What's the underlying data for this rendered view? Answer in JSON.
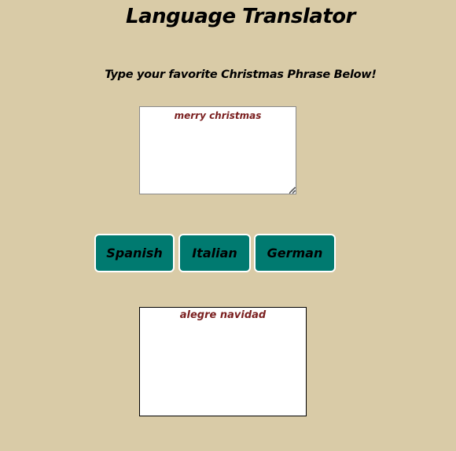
{
  "page": {
    "title": "Language Translator",
    "subtitle": "Type your favorite Christmas Phrase Below!"
  },
  "input": {
    "value": "merry christmas"
  },
  "buttons": {
    "spanish": "Spanish",
    "italian": "Italian",
    "german": "German"
  },
  "output": {
    "text": "alegre navidad"
  },
  "colors": {
    "background": "#d9cba7",
    "button": "#007a70",
    "text_accent": "#7a1f1f"
  }
}
